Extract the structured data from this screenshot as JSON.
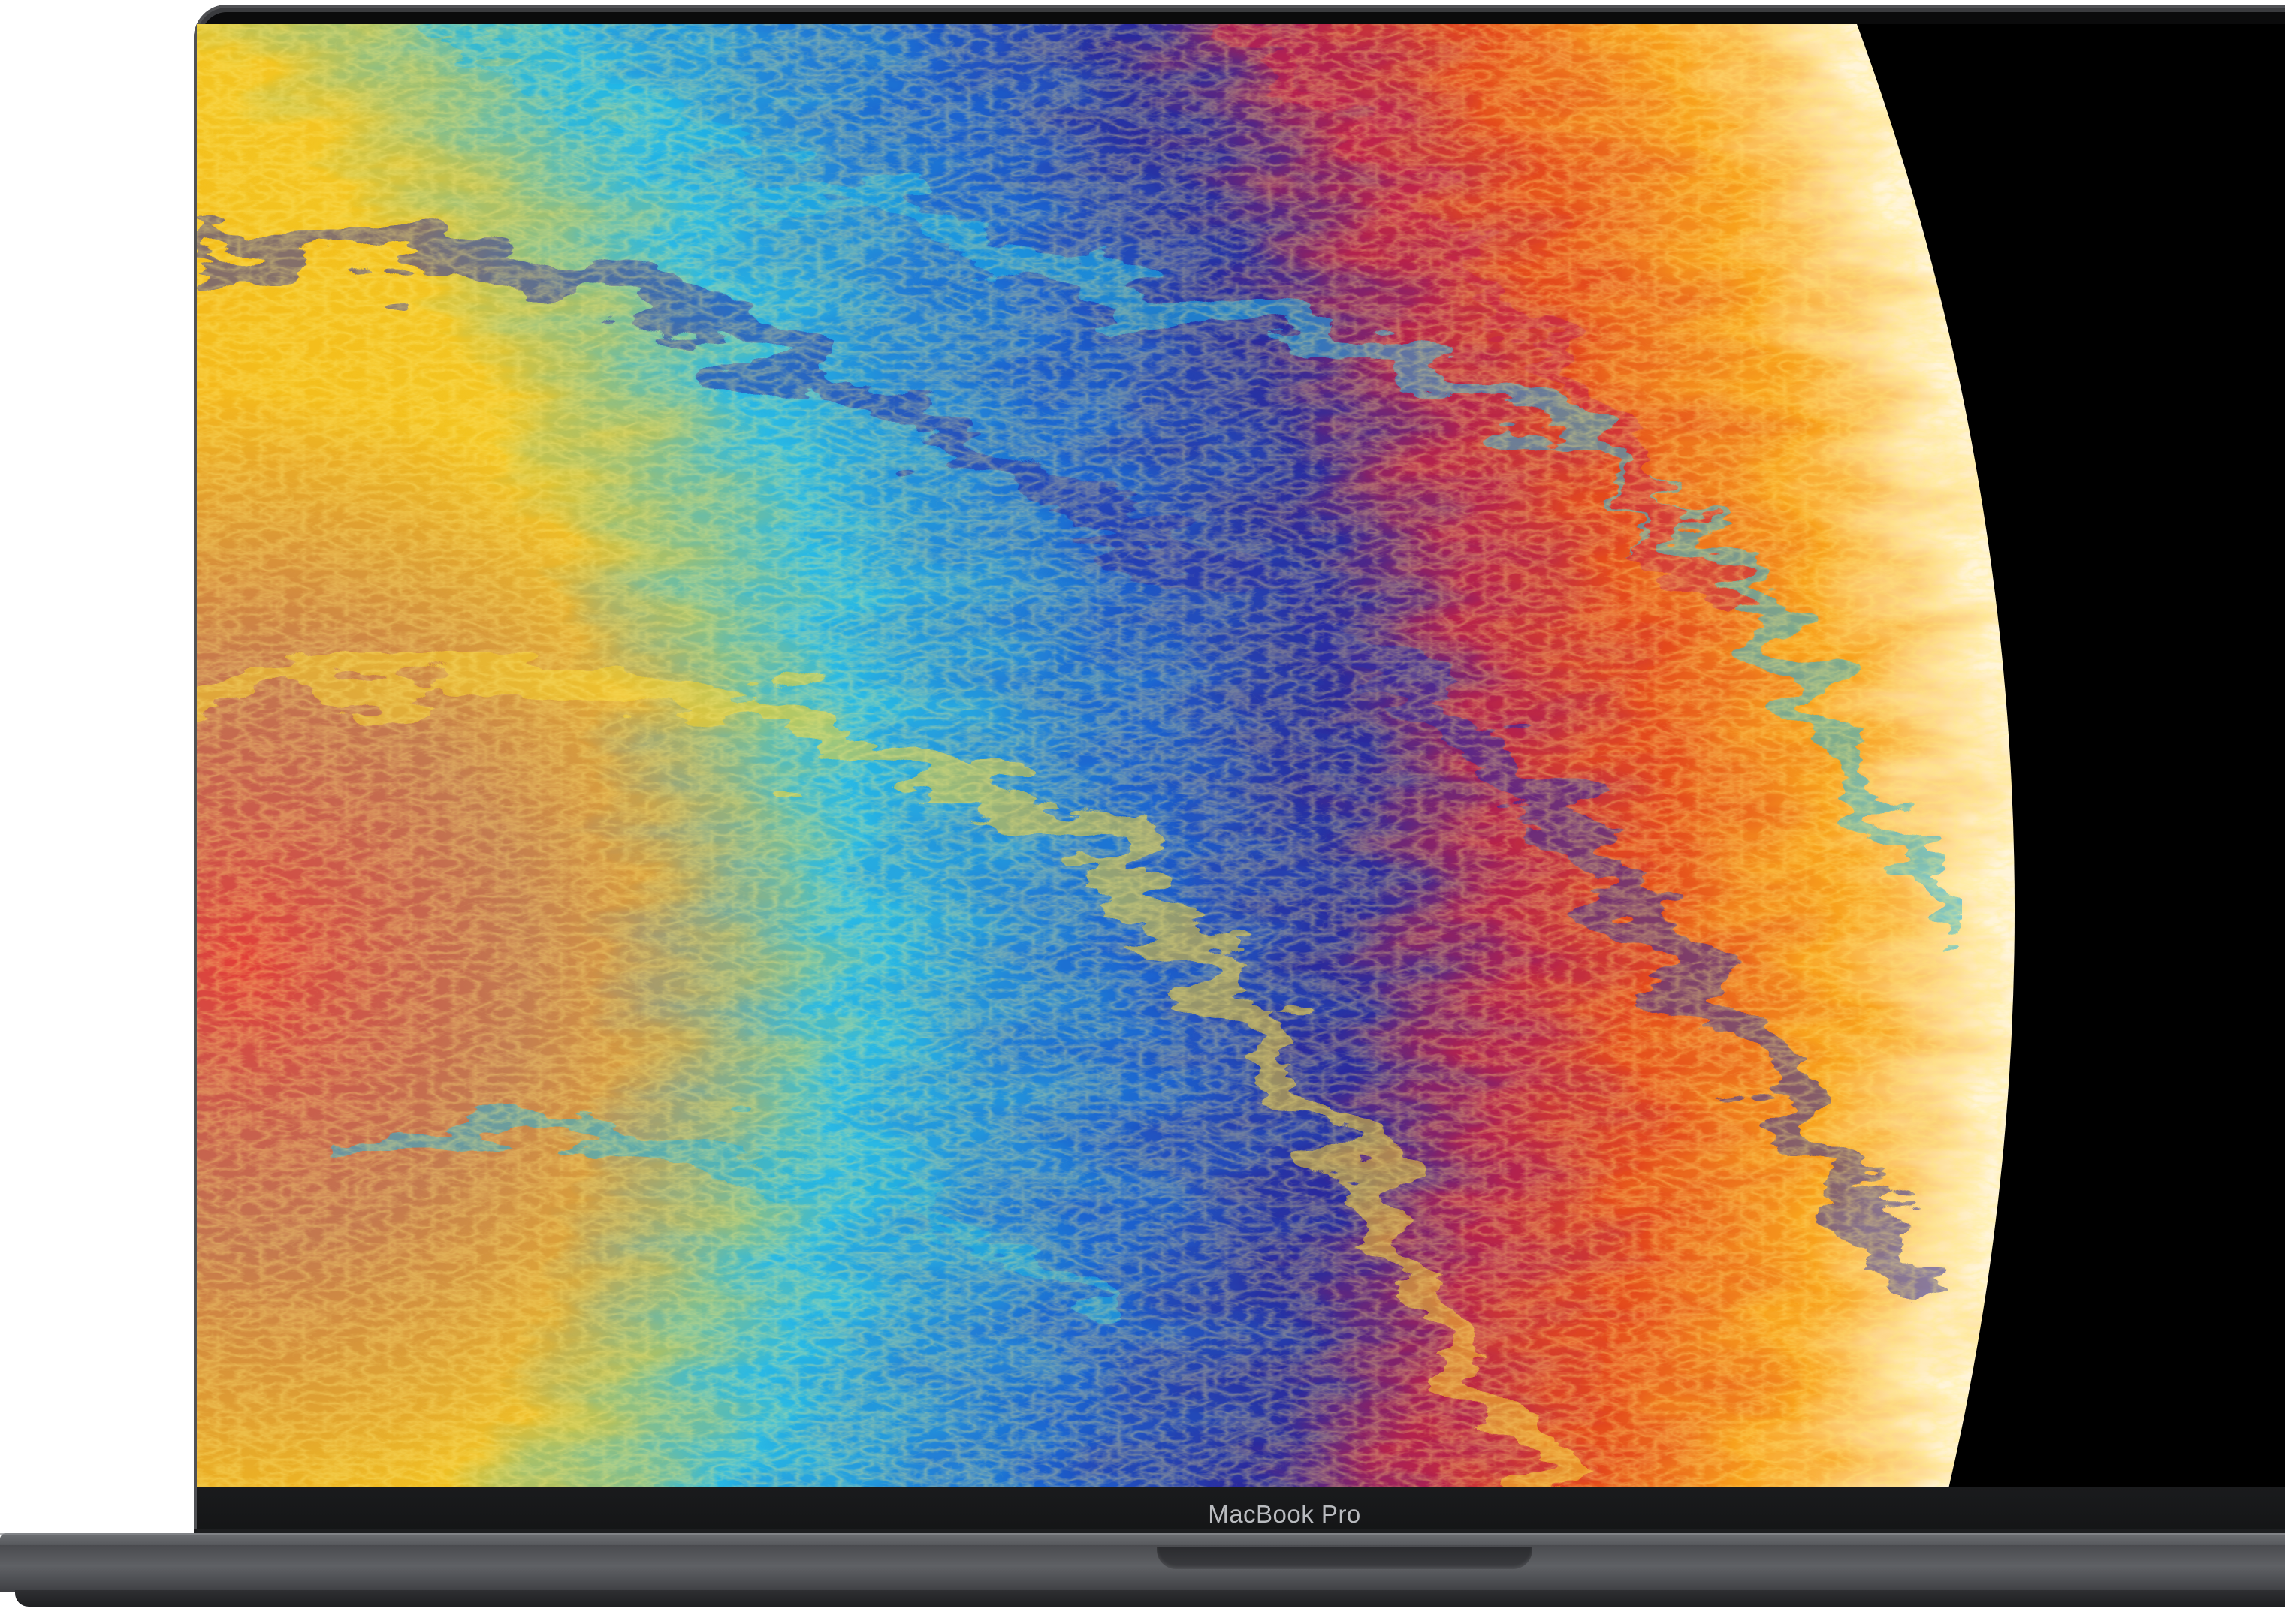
{
  "device": {
    "model_label": "MacBook Pro"
  },
  "wallpaper": {
    "description_icon": "iridescent-bubble-wallpaper",
    "palette": [
      "#f29a1a",
      "#f7c21f",
      "#ffdf3a",
      "#23b7e6",
      "#1f6fd6",
      "#2b2fa0",
      "#b01d52",
      "#e2451f",
      "#fff0c8"
    ],
    "background_color": "#000000"
  },
  "colors": {
    "lid": "#2c2d30",
    "bezel": "#0b0b0c",
    "base": "#55575b",
    "label": "#b9bbbf"
  }
}
